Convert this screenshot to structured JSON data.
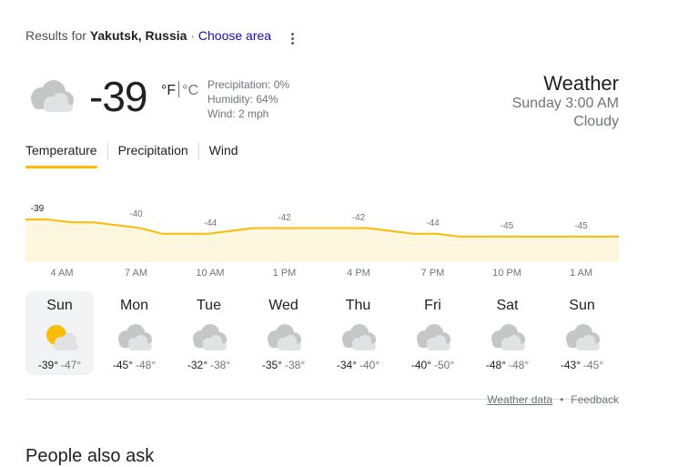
{
  "location": {
    "prefix": "Results for",
    "place": "Yakutsk, Russia",
    "separator": "·",
    "choose_area": "Choose area",
    "more_icon": "more-vert-icon"
  },
  "current": {
    "icon": "cloudy-icon",
    "temperature": "-39",
    "unit_f": "°F",
    "unit_c": "°C",
    "precipitation": "Precipitation: 0%",
    "humidity": "Humidity: 64%",
    "wind": "Wind: 2 mph"
  },
  "header": {
    "title": "Weather",
    "datetime": "Sunday 3:00 AM",
    "condition": "Cloudy"
  },
  "tabs": [
    {
      "label": "Temperature",
      "active": true
    },
    {
      "label": "Precipitation",
      "active": false
    },
    {
      "label": "Wind",
      "active": false
    }
  ],
  "hourly_chart": {
    "type": "area",
    "line_color": "#fbbc04",
    "fill_color": "#fef7e0",
    "labels": [
      "-39",
      "-40",
      "-44",
      "-42",
      "-42",
      "-44",
      "-45",
      "-45"
    ],
    "times": [
      "4 AM",
      "7 AM",
      "10 AM",
      "1 PM",
      "4 PM",
      "7 PM",
      "10 PM",
      "1 AM"
    ],
    "series_values": [
      -39,
      -39,
      -40,
      -40,
      -41,
      -42,
      -44,
      -44,
      -44,
      -43,
      -42,
      -42,
      -42,
      -42,
      -42,
      -42,
      -43,
      -44,
      -44,
      -45,
      -45,
      -45,
      -45,
      -45,
      -45,
      -45,
      -45
    ]
  },
  "daily": [
    {
      "day": "Sun",
      "icon": "partly-sunny-icon",
      "hi": "-39°",
      "lo": "-47°",
      "selected": true
    },
    {
      "day": "Mon",
      "icon": "cloudy-icon",
      "hi": "-45°",
      "lo": "-48°",
      "selected": false
    },
    {
      "day": "Tue",
      "icon": "cloudy-icon",
      "hi": "-32°",
      "lo": "-38°",
      "selected": false
    },
    {
      "day": "Wed",
      "icon": "cloudy-icon",
      "hi": "-35°",
      "lo": "-38°",
      "selected": false
    },
    {
      "day": "Thu",
      "icon": "cloudy-icon",
      "hi": "-34°",
      "lo": "-40°",
      "selected": false
    },
    {
      "day": "Fri",
      "icon": "cloudy-icon",
      "hi": "-40°",
      "lo": "-50°",
      "selected": false
    },
    {
      "day": "Sat",
      "icon": "cloudy-icon",
      "hi": "-48°",
      "lo": "-48°",
      "selected": false
    },
    {
      "day": "Sun",
      "icon": "cloudy-icon",
      "hi": "-43°",
      "lo": "-45°",
      "selected": false
    }
  ],
  "footer": {
    "weather_data": "Weather data",
    "dot": "•",
    "feedback": "Feedback"
  },
  "people_also_ask": "People also ask"
}
